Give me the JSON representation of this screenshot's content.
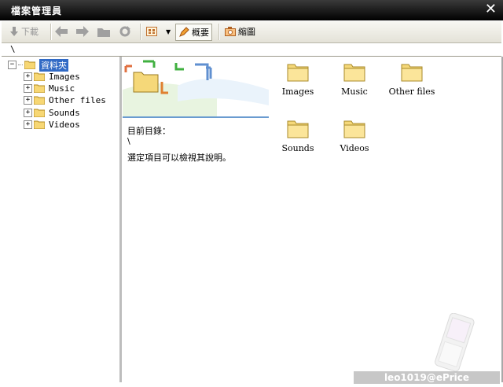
{
  "window": {
    "title": "檔案管理員",
    "close_glyph": "✕"
  },
  "toolbar": {
    "download_label": "下載",
    "summary_label": "概要",
    "thumbnail_label": "縮圖"
  },
  "path": {
    "value": "\\"
  },
  "tree": {
    "root_label": "資料夾",
    "items": [
      {
        "label": "Images"
      },
      {
        "label": "Music"
      },
      {
        "label": "Other files"
      },
      {
        "label": "Sounds"
      },
      {
        "label": "Videos"
      }
    ]
  },
  "info": {
    "current_dir_label": "目前目錄：",
    "current_dir_value": "\\",
    "hint": "選定項目可以檢視其說明。"
  },
  "folders": [
    {
      "label": "Images"
    },
    {
      "label": "Music"
    },
    {
      "label": "Other files"
    },
    {
      "label": "Sounds"
    },
    {
      "label": "Videos"
    }
  ],
  "watermark": "leo1019@ePrice"
}
